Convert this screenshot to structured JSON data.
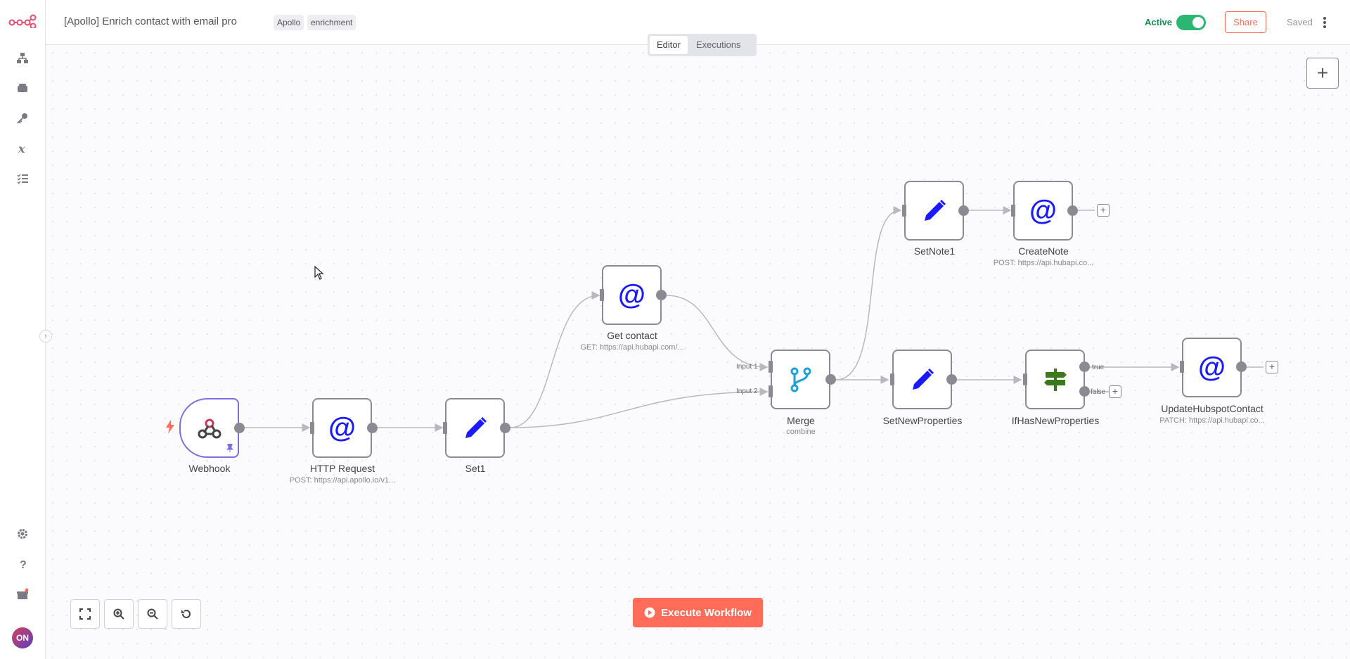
{
  "header": {
    "title": "[Apollo] Enrich contact with email pro",
    "tags": [
      "Apollo",
      "enrichment"
    ],
    "active_label": "Active",
    "share_label": "Share",
    "saved_label": "Saved"
  },
  "tabs": [
    "Editor",
    "Executions"
  ],
  "nodes": {
    "webhook": {
      "label": "Webhook",
      "sub": ""
    },
    "http_request": {
      "label": "HTTP Request",
      "sub": "POST: https://api.apollo.io/v1..."
    },
    "set1": {
      "label": "Set1",
      "sub": ""
    },
    "get_contact": {
      "label": "Get contact",
      "sub": "GET: https://api.hubapi.com/..."
    },
    "merge": {
      "label": "Merge",
      "sub": "combine"
    },
    "setnote1": {
      "label": "SetNote1",
      "sub": ""
    },
    "createnote": {
      "label": "CreateNote",
      "sub": "POST: https://api.hubapi.co..."
    },
    "setnewproperties": {
      "label": "SetNewProperties",
      "sub": ""
    },
    "ifhasnewproperties": {
      "label": "IfHasNewProperties",
      "sub": ""
    },
    "updatehubspotcontact": {
      "label": "UpdateHubspotContact",
      "sub": "PATCH: https://api.hubapi.co..."
    }
  },
  "port_labels": {
    "input1": "Input 1",
    "input2": "Input 2",
    "true": "true",
    "false": "false"
  },
  "execute_label": "Execute Workflow",
  "user_initials": "ON",
  "colors": {
    "accent": "#ff6d5a",
    "active": "#2bb673",
    "node_icon_blue": "#1a1aff"
  }
}
